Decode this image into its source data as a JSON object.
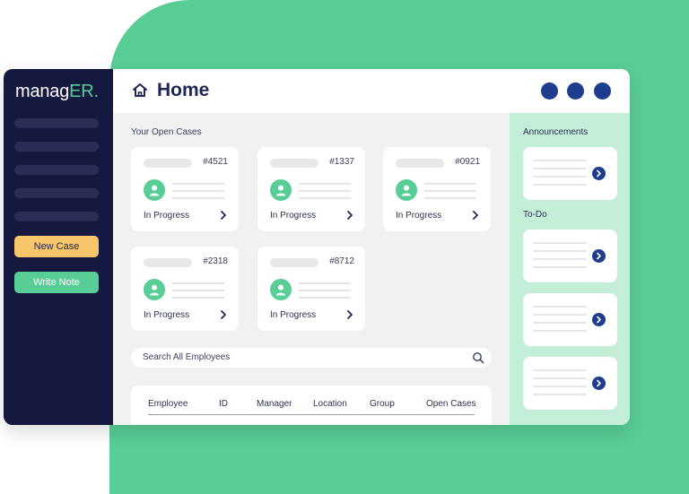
{
  "brand": {
    "logo_prefix": "manag",
    "logo_suffix": "ER",
    "logo_dot": "."
  },
  "header": {
    "title": "Home",
    "home_icon": "home-icon"
  },
  "sidebar": {
    "new_case_label": "New Case",
    "write_note_label": "Write Note"
  },
  "open_cases": {
    "label": "Your Open Cases",
    "cases": [
      {
        "id": "#4521",
        "status": "In Progress"
      },
      {
        "id": "#1337",
        "status": "In Progress"
      },
      {
        "id": "#0921",
        "status": "In Progress"
      },
      {
        "id": "#2318",
        "status": "In Progress"
      },
      {
        "id": "#8712",
        "status": "In Progress"
      }
    ]
  },
  "search": {
    "placeholder": "Search All Employees"
  },
  "employee_table": {
    "columns": [
      "Employee",
      "ID",
      "Manager",
      "Location",
      "Group",
      "Open Cases"
    ]
  },
  "right_panel": {
    "announcements_label": "Announcements",
    "todo_label": "To-Do"
  },
  "colors": {
    "brand_green": "#59cd96",
    "sidebar_navy": "#15183f",
    "accent_blue": "#1f3d8f",
    "new_case_yellow": "#f8c66a"
  }
}
